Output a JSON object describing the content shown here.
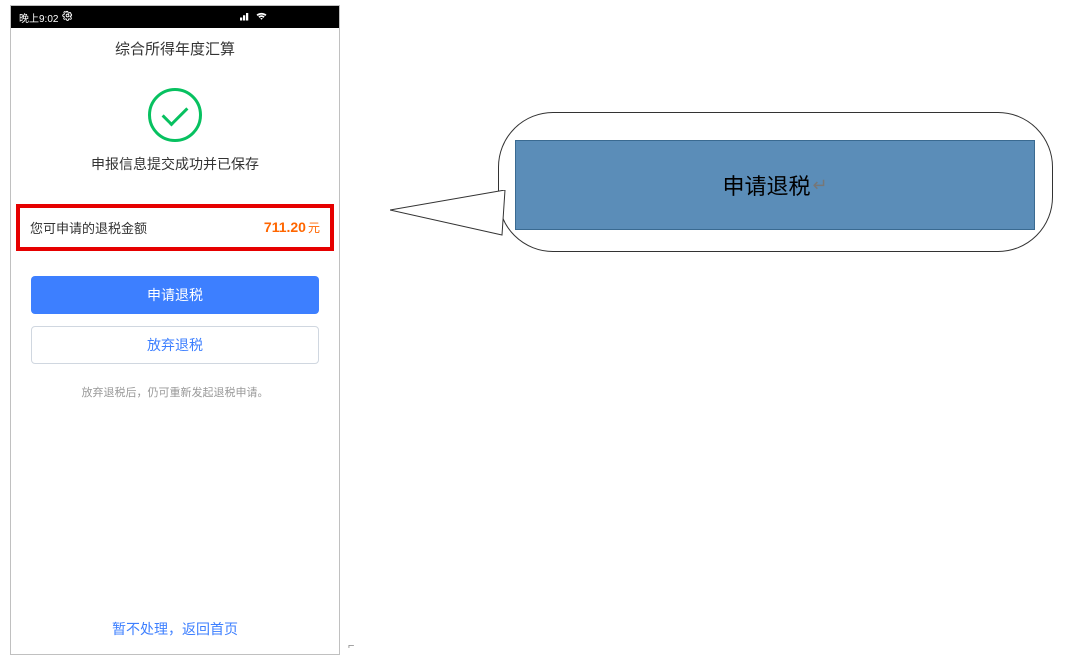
{
  "status_bar": {
    "time": "晚上9:02",
    "icon_name": "settings-icon"
  },
  "header": {
    "title": "综合所得年度汇算"
  },
  "hero": {
    "message": "申报信息提交成功并已保存"
  },
  "refund_row": {
    "label": "您可申请的退税金额",
    "amount": "711.20",
    "unit": "元"
  },
  "buttons": {
    "apply_label": "申请退税",
    "abandon_label": "放弃退税",
    "abandon_hint": "放弃退税后，仍可重新发起退税申请。"
  },
  "bottom_link": {
    "label": "暂不处理，返回首页"
  },
  "callout": {
    "text": "申请退税",
    "return_marker": "↵"
  }
}
